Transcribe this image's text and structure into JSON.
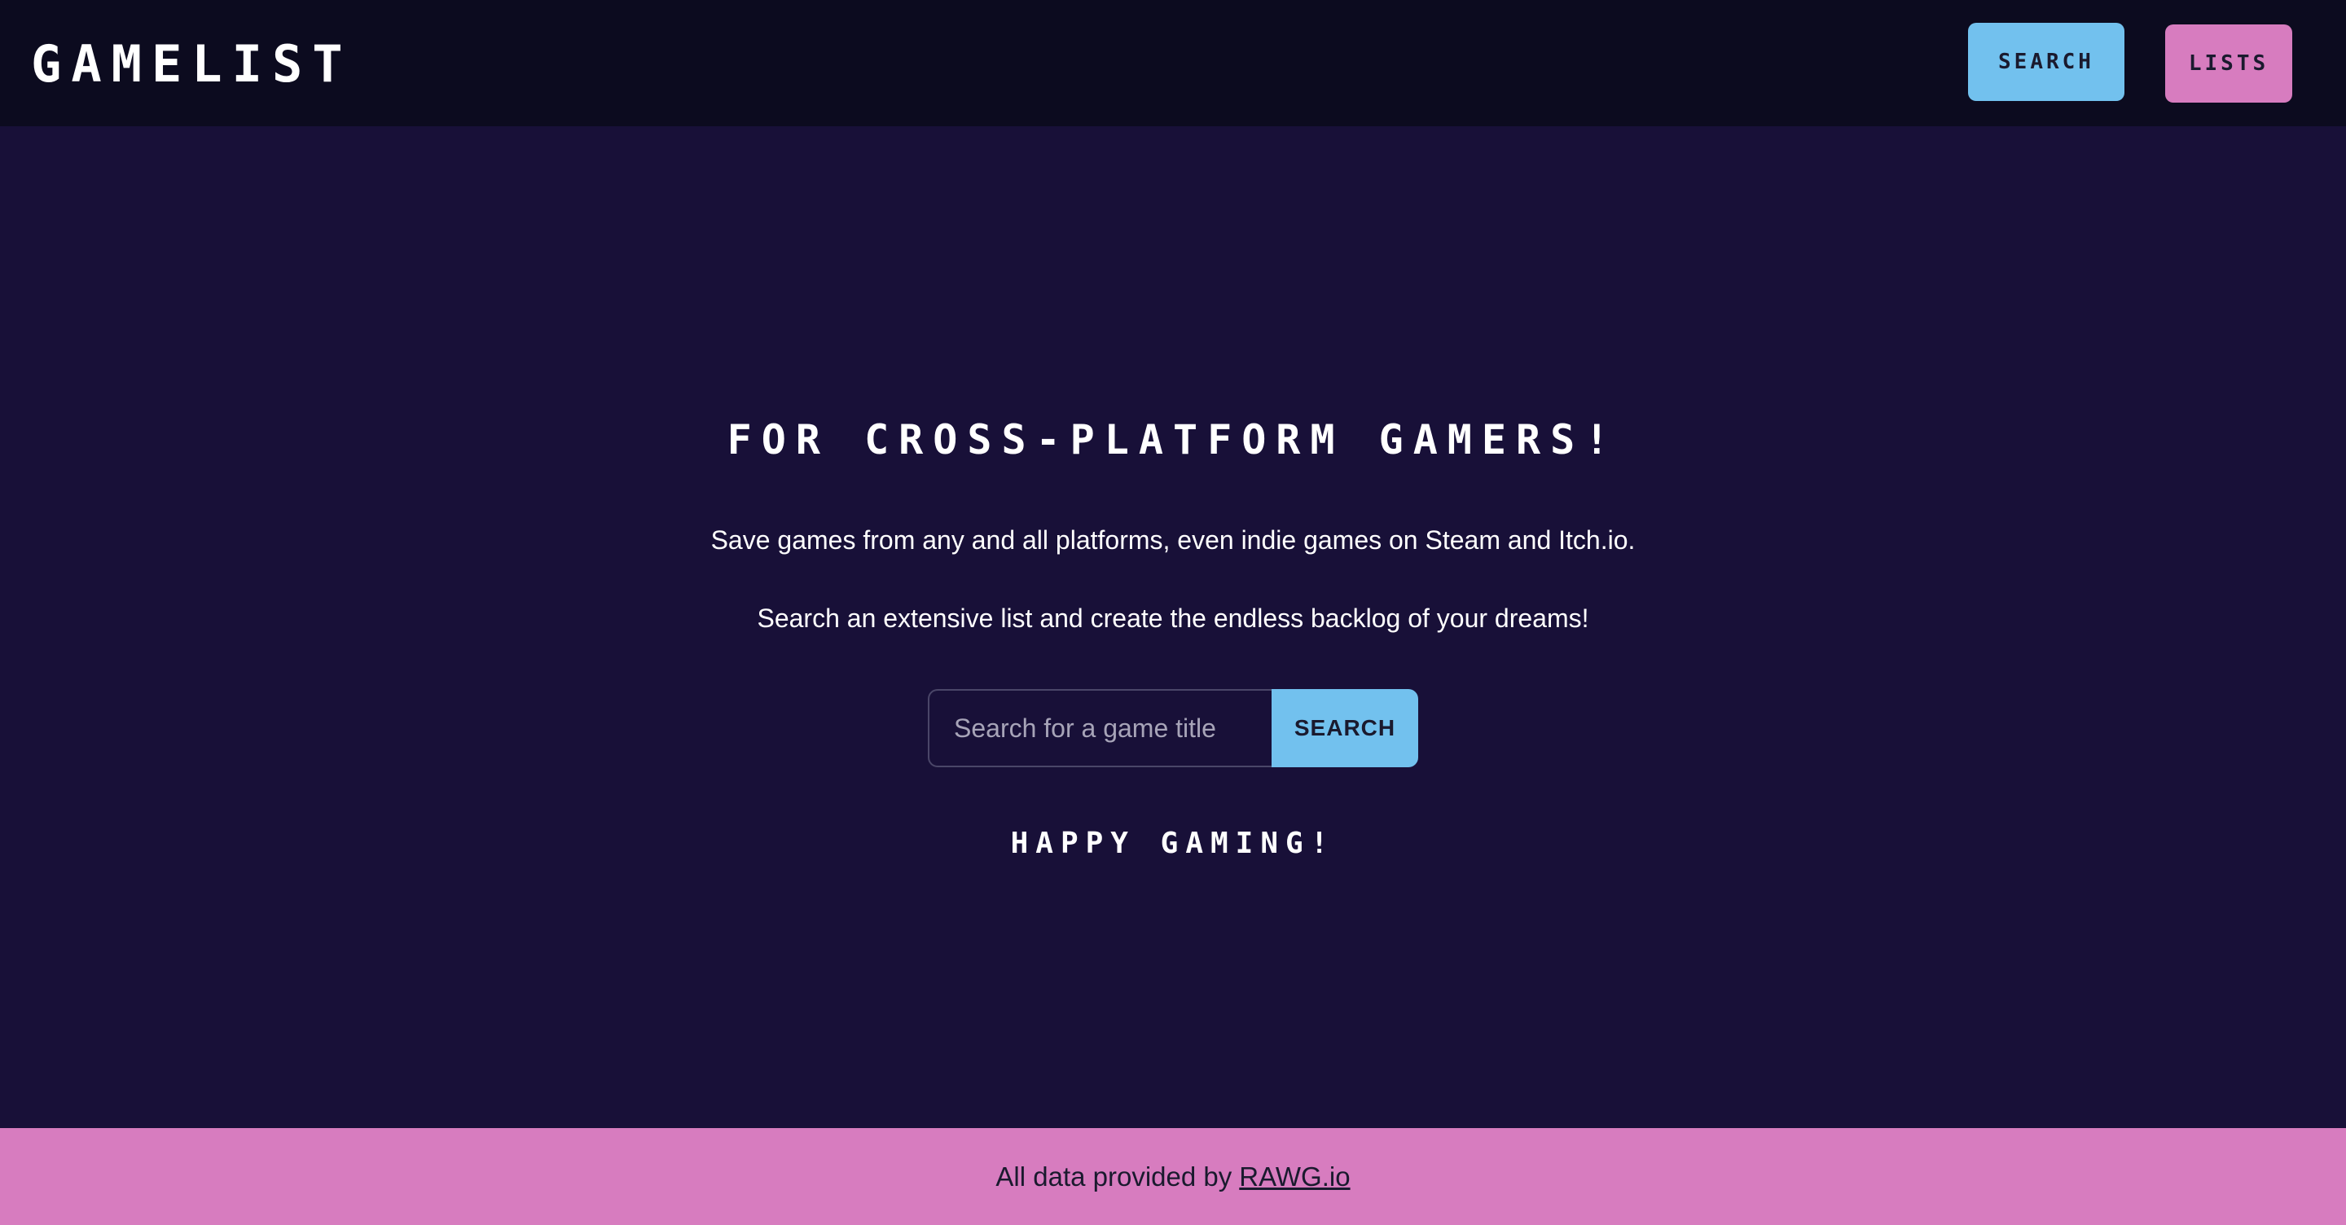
{
  "header": {
    "logo": "GAMELIST",
    "nav": {
      "search_label": "SEARCH",
      "lists_label": "LISTS"
    }
  },
  "hero": {
    "title": "FOR CROSS-PLATFORM GAMERS!",
    "line1": "Save games from any and all platforms, even indie games on Steam and Itch.io.",
    "line2": "Search an extensive list and create the endless backlog of your dreams!",
    "search": {
      "placeholder": "Search for a game title",
      "value": "",
      "button_label": "SEARCH"
    },
    "tagline": "HAPPY GAMING!"
  },
  "footer": {
    "text": "All data provided by",
    "link_text": "RAWG.io"
  },
  "colors": {
    "background": "#181038",
    "header_bg": "#0c0b1f",
    "accent_blue": "#72c1ee",
    "accent_pink": "#d77cbf",
    "text": "#ffffff"
  }
}
